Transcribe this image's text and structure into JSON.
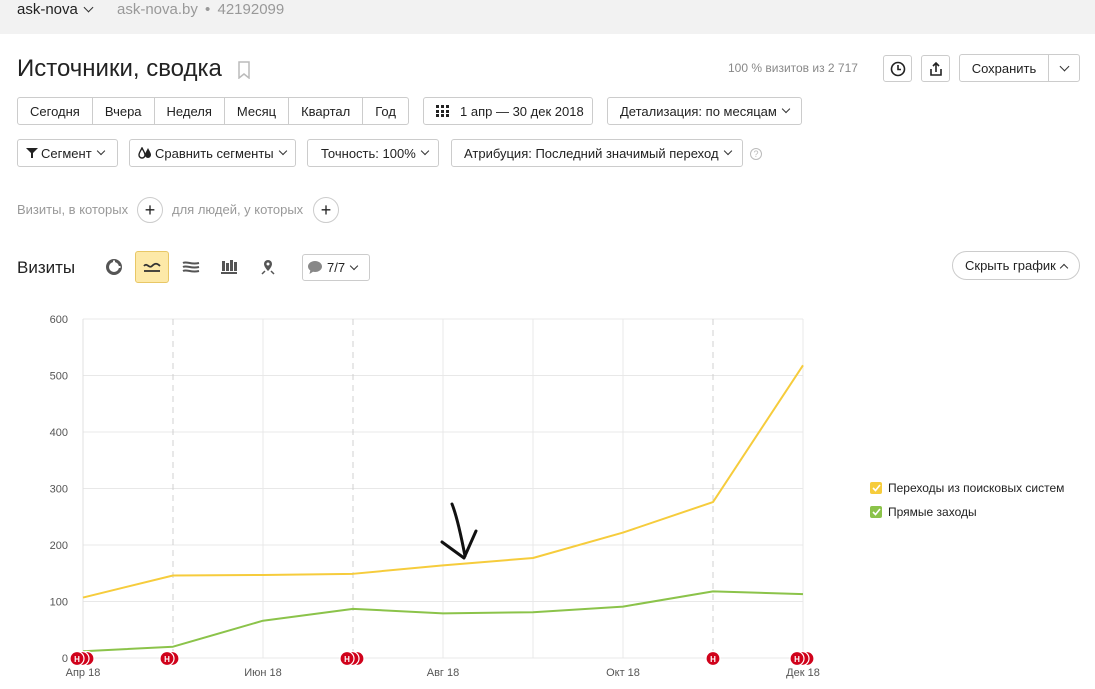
{
  "topbar": {
    "counter_name": "ask-nova",
    "domain": "ask-nova.by",
    "separator": "•",
    "counter_id": "42192099"
  },
  "header": {
    "title": "Источники, сводка",
    "visits_info": "100 % визитов из 2 717",
    "save_label": "Сохранить"
  },
  "periods": [
    "Сегодня",
    "Вчера",
    "Неделя",
    "Месяц",
    "Квартал",
    "Год"
  ],
  "date_range": "1 апр — 30 дек 2018",
  "detalization": "Детализация: по месяцам",
  "filters": {
    "segment": "Сегмент",
    "compare": "Сравнить сегменты",
    "accuracy": "Точность: 100%",
    "attribution": "Атрибуция: Последний значимый переход",
    "help": "?"
  },
  "conditions": {
    "visits_where": "Визиты, в которых",
    "people_where": "для людей, у которых",
    "plus": "+"
  },
  "chart_section": {
    "title": "Визиты",
    "notes_count": "7/7",
    "hide_label": "Скрыть график"
  },
  "colors": {
    "yellow": "#f6cc3c",
    "green": "#8bc34a",
    "note": "#d0021b"
  },
  "icons": [
    "clock-icon",
    "export-icon",
    "bookmark-icon",
    "pie-chart-icon",
    "line-chart-icon",
    "area-chart-icon",
    "bar-chart-icon",
    "map-icon",
    "comment-icon"
  ],
  "chart_data": {
    "type": "line",
    "ylabel": "",
    "xlabel": "",
    "ylim": [
      0,
      600
    ],
    "yticks": [
      0,
      100,
      200,
      300,
      400,
      500,
      600
    ],
    "x": [
      "2018-04",
      "2018-05",
      "2018-06",
      "2018-07",
      "2018-08",
      "2018-09",
      "2018-10",
      "2018-11",
      "2018-12"
    ],
    "xtick_labels": [
      {
        "at": 0,
        "label": "Апр 18"
      },
      {
        "at": 2,
        "label": "Июн 18"
      },
      {
        "at": 4,
        "label": "Авг 18"
      },
      {
        "at": 6,
        "label": "Окт 18"
      },
      {
        "at": 8,
        "label": "Дек 18"
      }
    ],
    "series": [
      {
        "name": "Переходы из поисковых систем",
        "color": "#f6cc3c",
        "values": [
          107,
          146,
          147,
          149,
          164,
          177,
          222,
          276,
          518
        ]
      },
      {
        "name": "Прямые заходы",
        "color": "#8bc34a",
        "values": [
          12,
          20,
          66,
          87,
          79,
          81,
          91,
          118,
          113
        ]
      }
    ],
    "note_markers": [
      {
        "at": 0,
        "count": 3
      },
      {
        "at": 1,
        "count": 2
      },
      {
        "at": 3,
        "count": 3
      },
      {
        "at": 7,
        "count": 1
      },
      {
        "at": 8,
        "count": 3
      }
    ],
    "note_letter": "Н",
    "grid": true,
    "legend": "right"
  }
}
